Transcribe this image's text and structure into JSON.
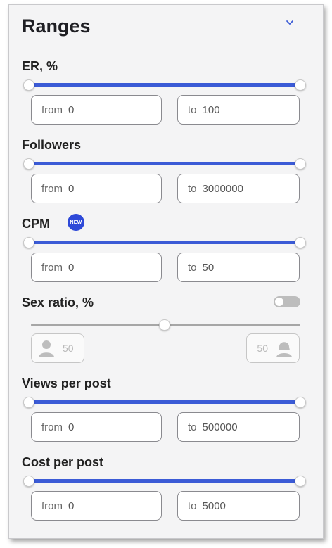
{
  "panel": {
    "title": "Ranges",
    "collapse_icon": "chevron-down-icon"
  },
  "er": {
    "label": "ER, %",
    "from_prefix": "from",
    "from_value": "0",
    "to_prefix": "to",
    "to_value": "100",
    "range_min_fraction": 0,
    "range_max_fraction": 1
  },
  "followers": {
    "label": "Followers",
    "from_prefix": "from",
    "from_value": "0",
    "to_prefix": "to",
    "to_value": "3000000",
    "range_min_fraction": 0,
    "range_max_fraction": 1
  },
  "cpm": {
    "label": "CPM",
    "badge": "NEW",
    "from_prefix": "from",
    "from_value": "0",
    "to_prefix": "to",
    "to_value": "50",
    "range_min_fraction": 0,
    "range_max_fraction": 1
  },
  "sex_ratio": {
    "label": "Sex ratio, %",
    "toggle_enabled": false,
    "slider_fraction": 0.5,
    "male_value": "50",
    "female_value": "50",
    "male_icon": "male-user-icon",
    "female_icon": "female-user-icon"
  },
  "views": {
    "label": "Views per post",
    "from_prefix": "from",
    "from_value": "0",
    "to_prefix": "to",
    "to_value": "500000",
    "range_min_fraction": 0,
    "range_max_fraction": 1
  },
  "cost": {
    "label": "Cost per post",
    "from_prefix": "from",
    "from_value": "0",
    "to_prefix": "to",
    "to_value": "5000",
    "range_min_fraction": 0,
    "range_max_fraction": 1
  },
  "colors": {
    "accent": "#3b5bd6",
    "badge": "#2e49d8",
    "panel_bg": "#f4f4f5"
  }
}
